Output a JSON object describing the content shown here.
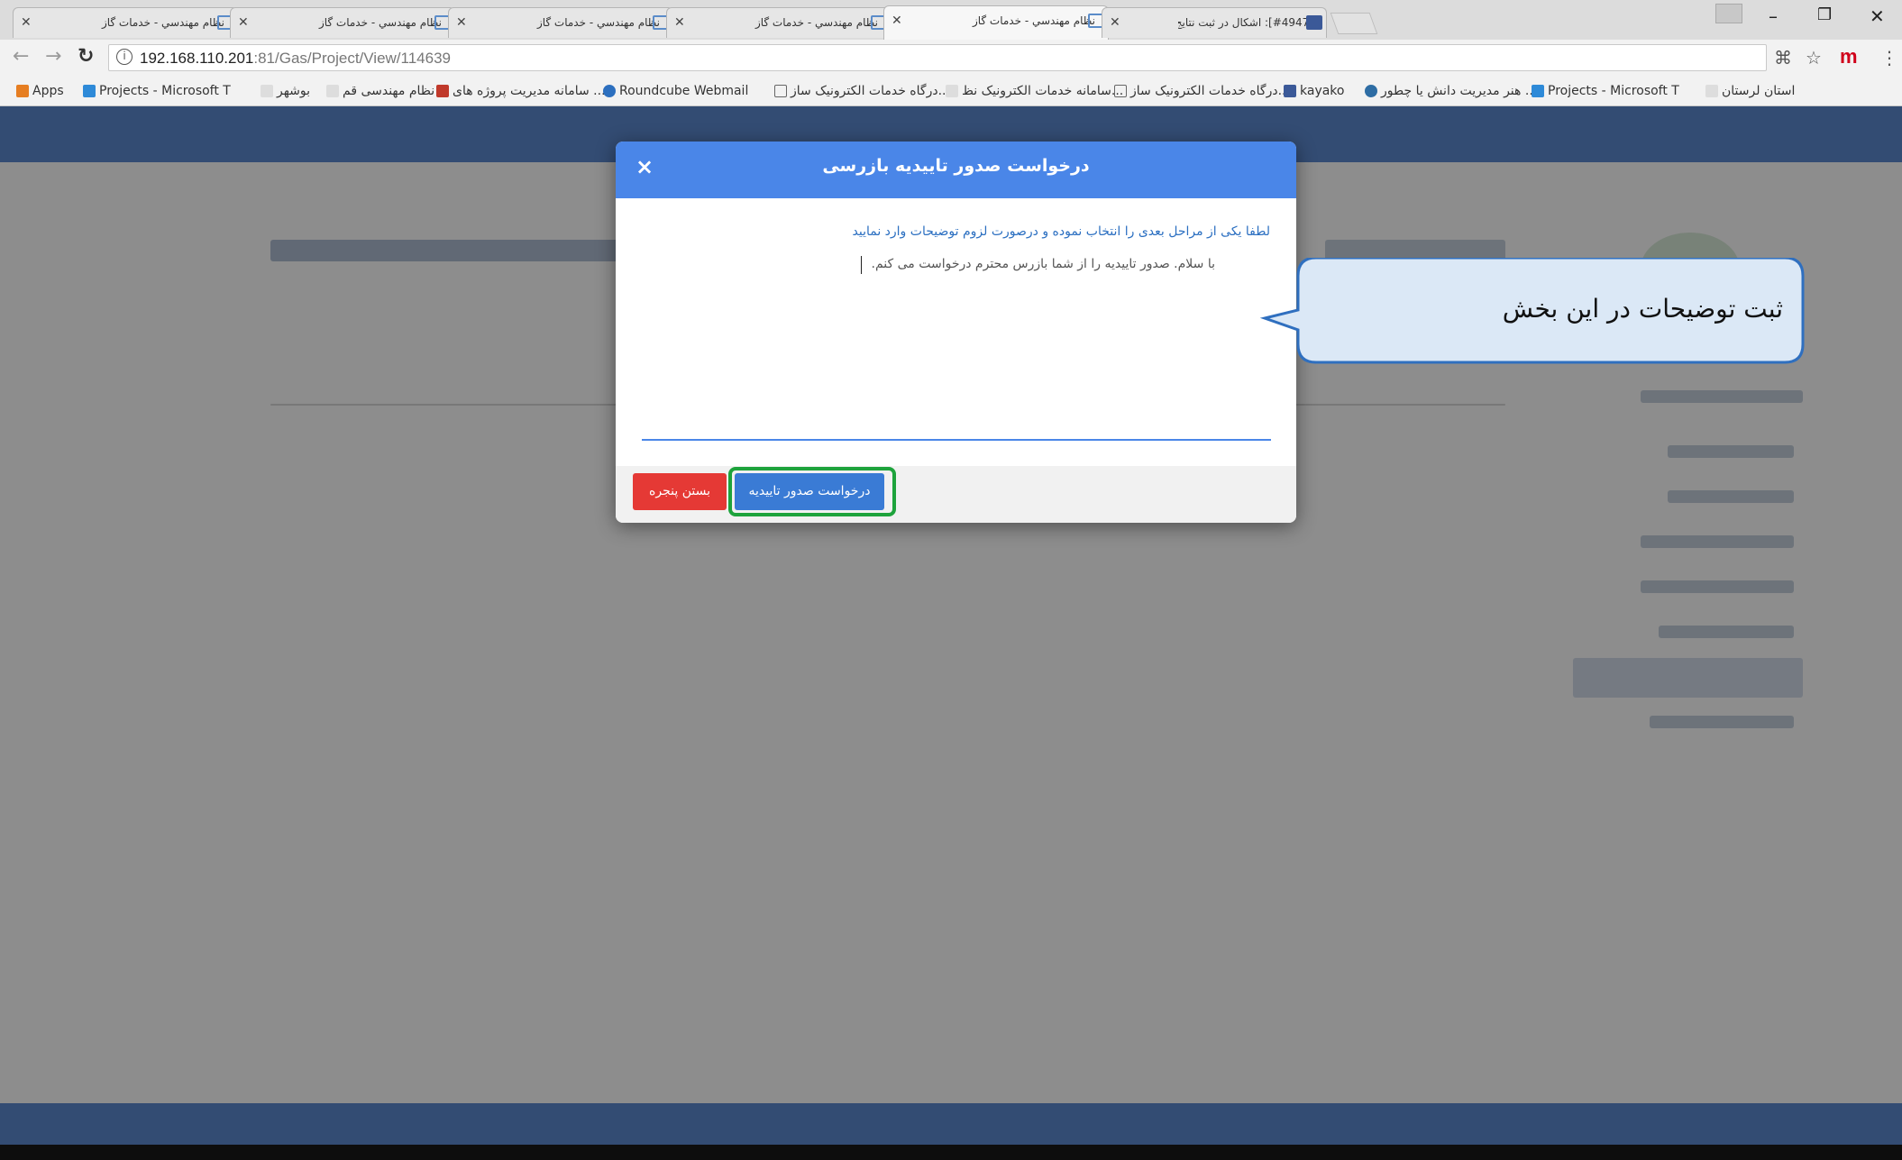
{
  "browser": {
    "tabs": [
      {
        "title": "نظام مهندسي - خدمات گاز"
      },
      {
        "title": "نظام مهندسي - خدمات گاز"
      },
      {
        "title": "نظام مهندسي - خدمات گاز"
      },
      {
        "title": "نظام مهندسي - خدمات گاز"
      },
      {
        "title": "نظام مهندسي - خدمات گاز"
      },
      {
        "title": "[#4947]: اشکال در ثبت نتایج"
      }
    ],
    "window_controls": {
      "minimize": "–",
      "restore": "❐",
      "close": "✕"
    },
    "url": {
      "host": "192.168.110.201",
      "rest": ":81/Gas/Project/View/114639"
    },
    "bookmarks": [
      {
        "label": "Apps",
        "color": "#e67e22"
      },
      {
        "label": "Projects - Microsoft T",
        "color": "#2e8ad8"
      },
      {
        "label": "بوشهر",
        "color": "#cccccc"
      },
      {
        "label": "نظام مهندسی قم",
        "color": "#cccccc"
      },
      {
        "label": "سامانه مدیریت پروژه های ...",
        "color": "#c0392b"
      },
      {
        "label": "Roundcube Webmail",
        "color": "#2c6fbf"
      },
      {
        "label": "درگاه خدمات الکترونیک ساز...",
        "color": "#ffffff"
      },
      {
        "label": "سامانه خدمات الکترونیک نظ...",
        "color": "#cccccc"
      },
      {
        "label": "درگاه خدمات الکترونیک ساز...",
        "color": "#ffffff"
      },
      {
        "label": "kayako",
        "color": "#3b5998"
      },
      {
        "label": "هنر مدیریت دانش یا چطور ...",
        "color": "#2e6da4"
      },
      {
        "label": "Projects - Microsoft T",
        "color": "#2e8ad8"
      },
      {
        "label": "استان لرستان",
        "color": "#cccccc"
      }
    ]
  },
  "modal": {
    "title": "درخواست صدور تاییدیه بازرسی",
    "close_glyph": "×",
    "hint": "لطفا یکی از مراحل بعدی را انتخاب نموده و درصورت لزوم توضیحات وارد نمایید",
    "text_value": "با سلام. صدور تاییدیه را از شما بازرس محترم درخواست می کنم.",
    "request_button": "درخواست صدور تاییدیه",
    "close_button": "بستن پنجره"
  },
  "callout": {
    "text": "ثبت توضیحات در این بخش"
  },
  "colors": {
    "header_blue": "#4a86e8",
    "danger_red": "#e53935",
    "highlight_green": "#1ea33c"
  }
}
